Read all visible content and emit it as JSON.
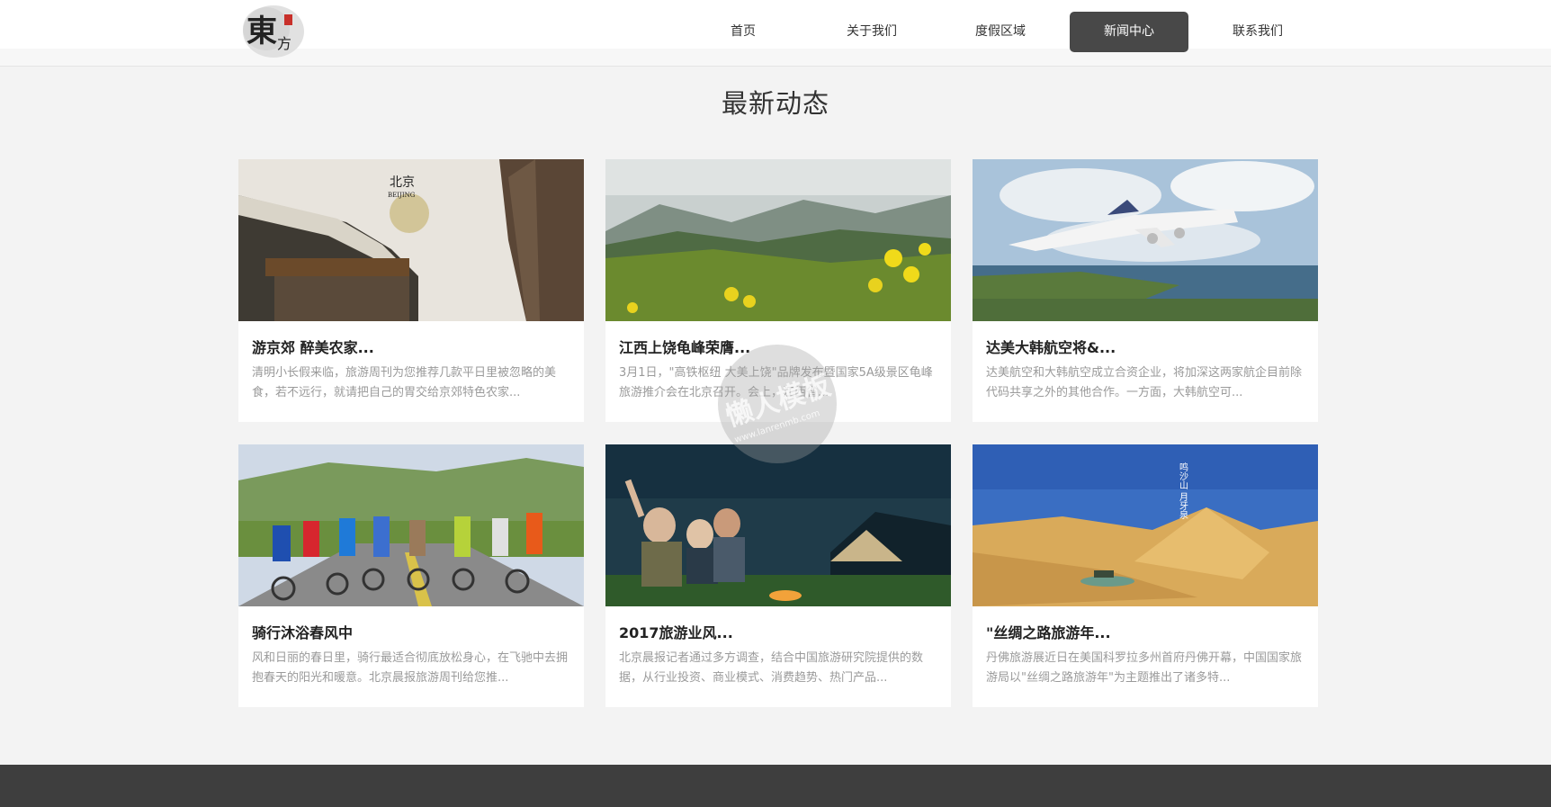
{
  "logo": {
    "text": "東方"
  },
  "nav": {
    "items": [
      {
        "label": "首页",
        "active": false
      },
      {
        "label": "关于我们",
        "active": false
      },
      {
        "label": "度假区域",
        "active": false
      },
      {
        "label": "新闻中心",
        "active": true
      },
      {
        "label": "联系我们",
        "active": false
      }
    ]
  },
  "section": {
    "title": "最新动态"
  },
  "cards": [
    {
      "title": "游京郊 醉美农家...",
      "desc": "清明小长假来临，旅游周刊为您推荐几款平日里被忽略的美食，若不远行，就请把自己的胃交给京郊特色农家...",
      "image_text": "北京",
      "image_subtext": "BEIJING"
    },
    {
      "title": "江西上饶龟峰荣膺...",
      "desc": "3月1日，\"高铁枢纽 大美上饶\"品牌发布暨国家5A级景区龟峰旅游推介会在北京召开。会上，江西省..."
    },
    {
      "title": "达美大韩航空将&...",
      "desc": "达美航空和大韩航空成立合资企业，将加深这两家航企目前除代码共享之外的其他合作。一方面，大韩航空可..."
    },
    {
      "title": "骑行沐浴春风中",
      "desc": "风和日丽的春日里，骑行最适合彻底放松身心，在飞驰中去拥抱春天的阳光和暖意。北京晨报旅游周刊给您推..."
    },
    {
      "title": "2017旅游业风...",
      "desc": "北京晨报记者通过多方调查，结合中国旅游研究院提供的数据，从行业投资、商业模式、消费趋势、热门产品..."
    },
    {
      "title": "\"丝绸之路旅游年...",
      "desc": "丹佛旅游展近日在美国科罗拉多州首府丹佛开幕，中国国家旅游局以\"丝绸之路旅游年\"为主题推出了诸多特...",
      "image_text": "鸣沙山 月牙泉"
    }
  ],
  "watermark": {
    "line1": "懒人模板",
    "line2": "www.lanrenmb.com"
  }
}
